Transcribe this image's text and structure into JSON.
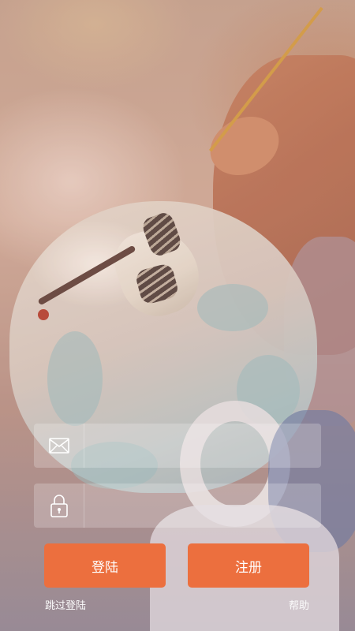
{
  "login_form": {
    "email": {
      "icon": "mail-icon",
      "value": "",
      "placeholder": ""
    },
    "password": {
      "icon": "lock-icon",
      "value": "",
      "placeholder": ""
    },
    "login_label": "登陆",
    "register_label": "注册",
    "skip_label": "跳过登陆",
    "help_label": "帮助"
  },
  "colors": {
    "button": "#ec6f3e",
    "text": "#ffffff"
  },
  "background": {
    "subject": "background-photo"
  }
}
